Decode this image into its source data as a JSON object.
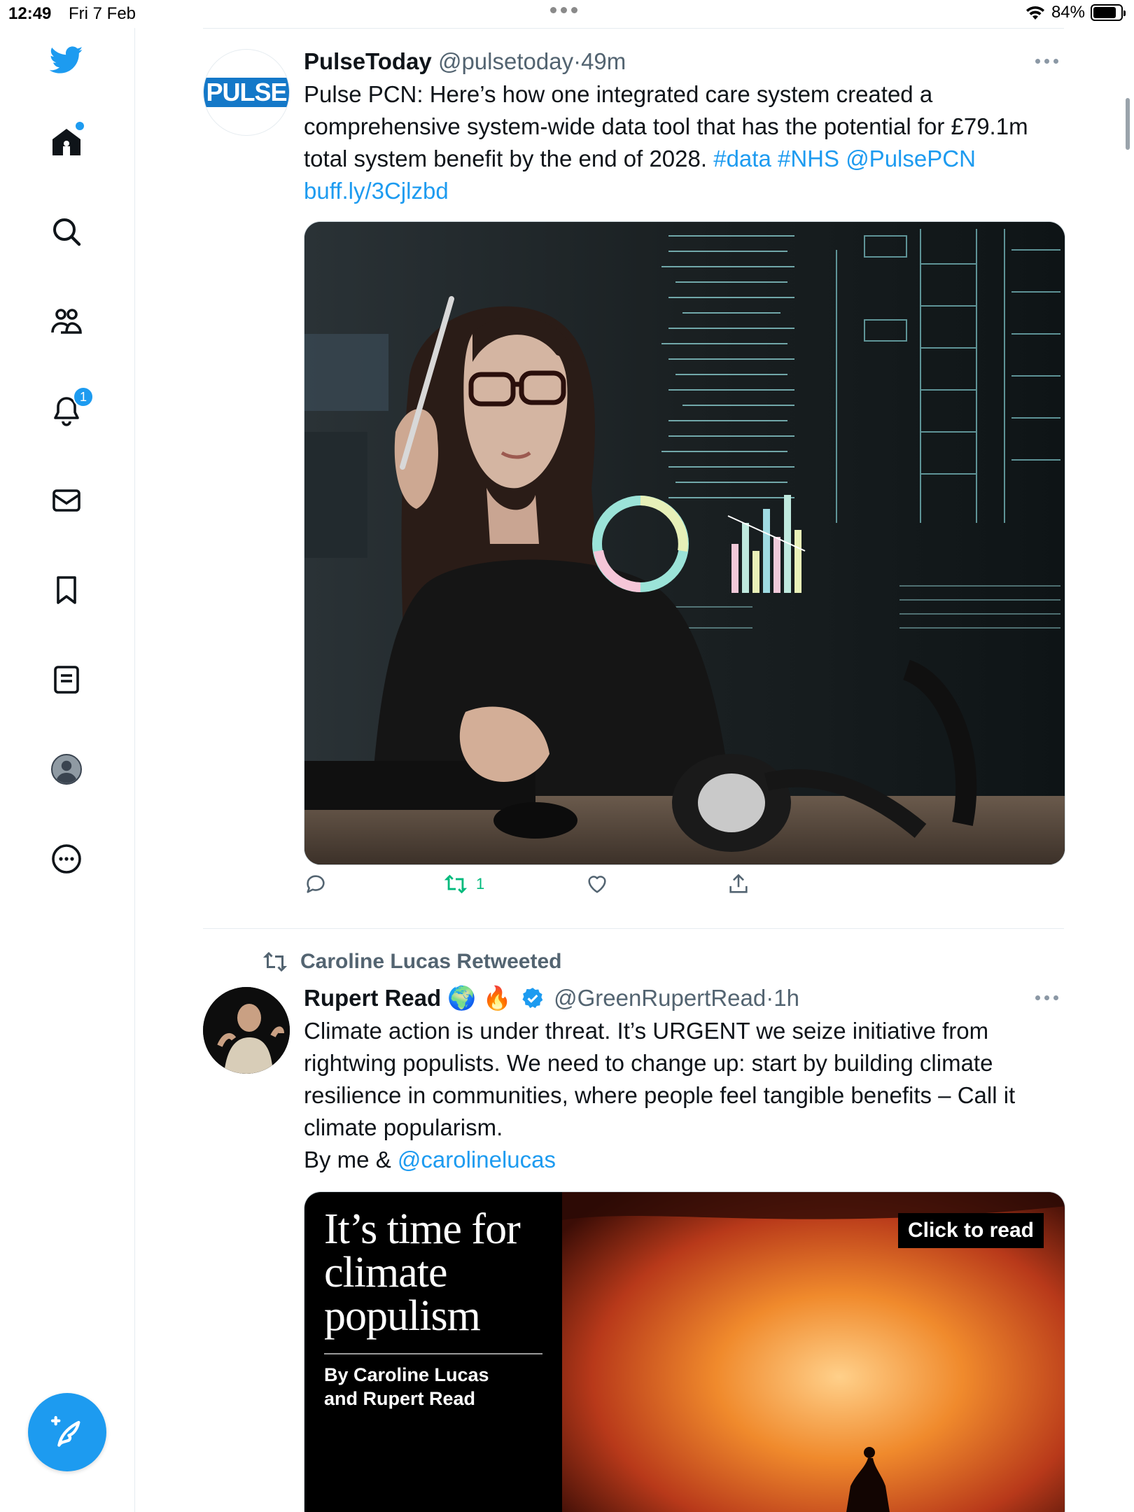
{
  "status_bar": {
    "time": "12:49",
    "date": "Fri 7 Feb",
    "battery_percent": "84%",
    "battery_level": 0.84
  },
  "sidebar": {
    "items": [
      {
        "icon": "twitter-logo-icon"
      },
      {
        "icon": "home-icon",
        "has_dot": true
      },
      {
        "icon": "search-icon"
      },
      {
        "icon": "communities-icon"
      },
      {
        "icon": "notifications-bell-icon",
        "badge": "1"
      },
      {
        "icon": "messages-envelope-icon"
      },
      {
        "icon": "bookmark-icon"
      },
      {
        "icon": "lists-icon"
      },
      {
        "icon": "profile-avatar-icon"
      },
      {
        "icon": "more-circle-icon"
      }
    ],
    "compose_icon": "compose-feather-icon"
  },
  "colors": {
    "accent": "#1d9bf0",
    "retweet_green": "#00ba7c",
    "text_secondary": "#536471"
  },
  "tweets": [
    {
      "avatar_text": "PULSE",
      "name": "PulseToday",
      "handle": "@pulsetoday",
      "separator": "·",
      "time": "49m",
      "text_plain": "Pulse PCN:  Here’s how one integrated care system created a comprehensive system-wide data tool that has the potential for £79.1m total system benefit by the end of 2028.",
      "hashtag_1": "#data",
      "hashtag_2": "#NHS",
      "mention": "@PulsePCN",
      "link": "buff.ly/3Cjlzbd",
      "media_alt": "woman-with-glasses-data-screen-image",
      "retweet_count": "1"
    },
    {
      "retweeted_by": "Caroline Lucas Retweeted",
      "name": "Rupert Read",
      "emoji_1": "🌍",
      "emoji_2": "🔥",
      "handle": "@GreenRupertRead",
      "separator": "·",
      "time": "1h",
      "text_line_1": "Climate action is under threat.  It’s URGENT we seize initiative from rightwing populists.  We need to change up: start by building climate resilience in communities, where people feel tangible benefits – Call it climate popularism.",
      "text_line_2_prefix": "By me &",
      "mention": "@carolinelucas",
      "card": {
        "title": "It’s time for climate populism",
        "byline_1": "By Caroline Lucas",
        "byline_2": "and Rupert Read",
        "badge": "Click to read"
      }
    }
  ]
}
